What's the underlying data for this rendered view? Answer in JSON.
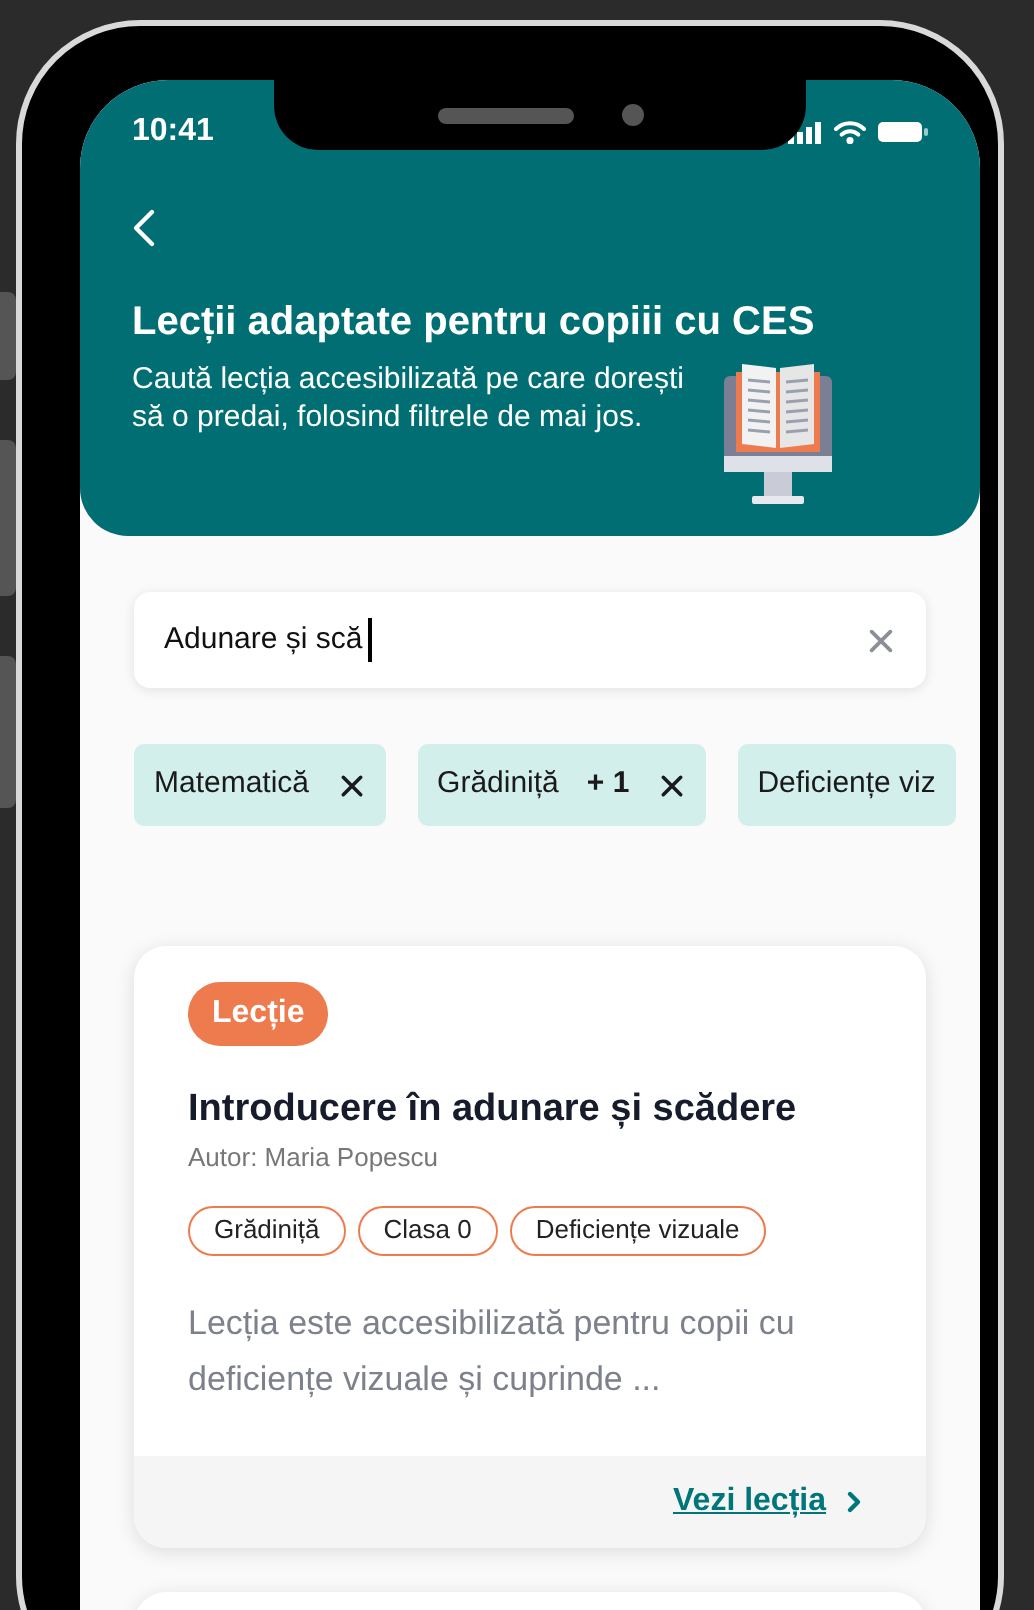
{
  "status_bar": {
    "time": "10:41"
  },
  "header": {
    "title": "Lecții adaptate pentru copiii cu CES",
    "subtitle": "Caută lecția accesibilizată pe care dorești să o predai, folosind filtrele de mai jos."
  },
  "search": {
    "value": "Adunare și scă"
  },
  "filters": [
    {
      "label": "Matematică"
    },
    {
      "label": "Grădiniță",
      "count": "+ 1"
    },
    {
      "label": "Deficiențe viz"
    }
  ],
  "lessons": [
    {
      "badge": "Lecție",
      "title": "Introducere în adunare și scădere",
      "author": "Autor: Maria Popescu",
      "tags": [
        "Grădiniță",
        "Clasa 0",
        "Deficiențe vizuale"
      ],
      "description": "Lecția este accesibilizată pentru copii cu deficiențe vizuale și cuprinde ...",
      "link": "Vezi lecția"
    }
  ]
}
